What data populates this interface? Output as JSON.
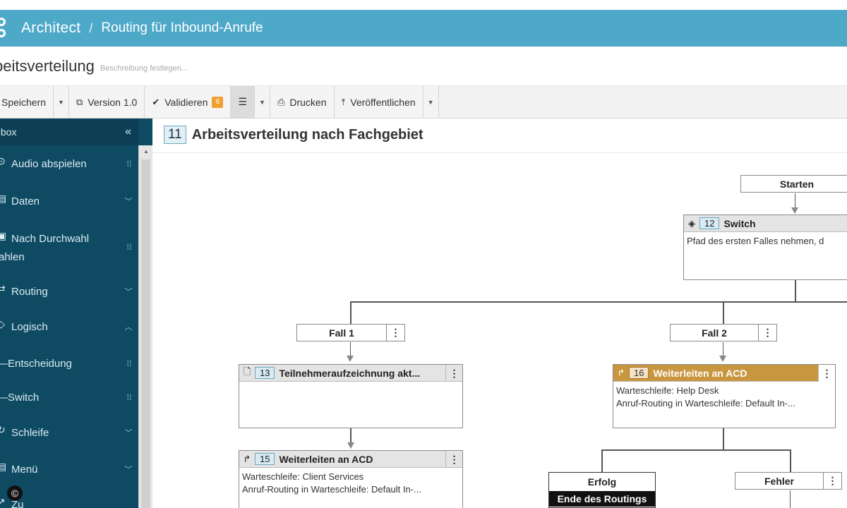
{
  "header": {
    "app_name": "Architect",
    "separator": "/",
    "flow_name": "Routing für Inbound-Anrufe"
  },
  "titlebar": {
    "title": "beitsverteilung",
    "description_placeholder": "Beschreibung festlegen..."
  },
  "toolbar": {
    "save": "Speichern",
    "version": "Version 1.0",
    "validate": "Validieren",
    "validate_badge": "6",
    "print": "Drucken",
    "publish": "Veröffentlichen"
  },
  "sidebar": {
    "header": "olbox",
    "items": [
      {
        "label": "Audio abspielen",
        "icon": "play-circle-icon"
      },
      {
        "label": "Daten",
        "icon": "database-icon"
      },
      {
        "label_line1": "Nach Durchwahl",
        "label_line2": "ahlen",
        "icon": "dialpad-icon"
      },
      {
        "label": "Routing",
        "icon": "routing-icon"
      },
      {
        "label": "Logisch",
        "icon": "diamond-icon"
      },
      {
        "label": "—Entscheidung"
      },
      {
        "label": "—Switch"
      },
      {
        "label": "Schleife",
        "icon": "loop-icon"
      },
      {
        "label": "Menü",
        "icon": "menu-icon"
      },
      {
        "label": "Zu",
        "icon": "transfer-icon"
      }
    ]
  },
  "canvas": {
    "title_number": "11",
    "title": "Arbeitsverteilung nach Fachgebiet",
    "start_label": "Starten",
    "switch_node": {
      "number": "12",
      "title": "Switch",
      "body": "Pfad des ersten Falles nehmen, d"
    },
    "case1": "Fall 1",
    "case2": "Fall 2",
    "node13": {
      "number": "13",
      "title": "Teilnehmeraufzeichnung akt...",
      "body": ""
    },
    "node15": {
      "number": "15",
      "title": "Weiterleiten an ACD",
      "line1": "Warteschleife: Client Services",
      "line2": "Anruf-Routing in Warteschleife: Default In-..."
    },
    "node16": {
      "number": "16",
      "title": "Weiterleiten an ACD",
      "line1": "Warteschleife: Help Desk",
      "line2": "Anruf-Routing in Warteschleife: Default In-..."
    },
    "success_label": "Erfolg",
    "success_end": "Ende des Routings",
    "failure_label": "Fehler",
    "menu_glyph": "⋮"
  },
  "copyright": "©",
  "colors": {
    "header_bg": "#4ea9c9",
    "sidebar_bg": "#0f4a63",
    "orange_header": "#c8963e"
  }
}
